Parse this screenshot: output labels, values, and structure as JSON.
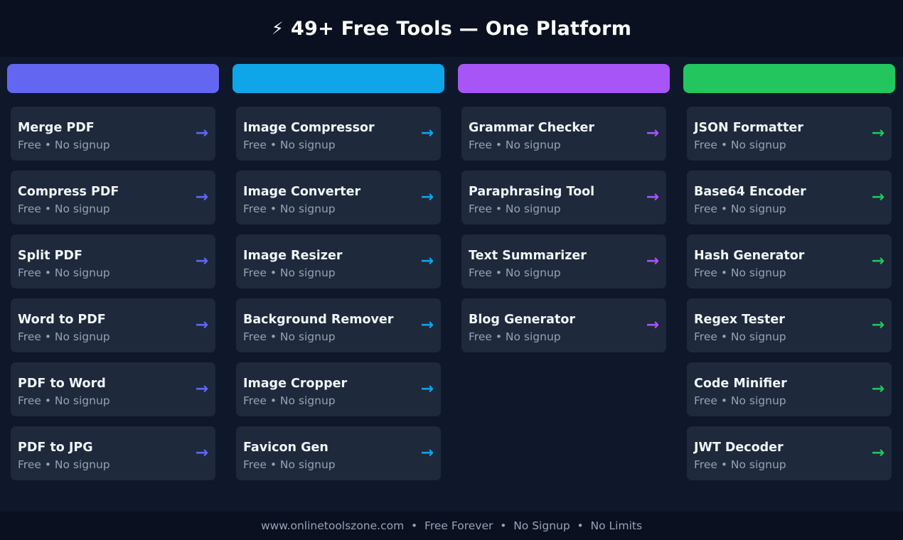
{
  "header": {
    "icon": "lightning-bolt-icon",
    "icon_glyph": "⚡",
    "title": "49+ Free Tools — One Platform"
  },
  "columns": [
    {
      "color": "#6366f1",
      "tools": [
        {
          "name": "Merge PDF",
          "subtitle": "Free • No signup"
        },
        {
          "name": "Compress PDF",
          "subtitle": "Free • No signup"
        },
        {
          "name": "Split PDF",
          "subtitle": "Free • No signup"
        },
        {
          "name": "Word to PDF",
          "subtitle": "Free • No signup"
        },
        {
          "name": "PDF to Word",
          "subtitle": "Free • No signup"
        },
        {
          "name": "PDF to JPG",
          "subtitle": "Free • No signup"
        }
      ]
    },
    {
      "color": "#0ea5e9",
      "tools": [
        {
          "name": "Image Compressor",
          "subtitle": "Free • No signup"
        },
        {
          "name": "Image Converter",
          "subtitle": "Free • No signup"
        },
        {
          "name": "Image Resizer",
          "subtitle": "Free • No signup"
        },
        {
          "name": "Background Remover",
          "subtitle": "Free • No signup"
        },
        {
          "name": "Image Cropper",
          "subtitle": "Free • No signup"
        },
        {
          "name": "Favicon Gen",
          "subtitle": "Free • No signup"
        }
      ]
    },
    {
      "color": "#a855f7",
      "tools": [
        {
          "name": "Grammar Checker",
          "subtitle": "Free • No signup"
        },
        {
          "name": "Paraphrasing Tool",
          "subtitle": "Free • No signup"
        },
        {
          "name": "Text Summarizer",
          "subtitle": "Free • No signup"
        },
        {
          "name": "Blog Generator",
          "subtitle": "Free • No signup"
        }
      ]
    },
    {
      "color": "#22c55e",
      "tools": [
        {
          "name": "JSON Formatter",
          "subtitle": "Free • No signup"
        },
        {
          "name": "Base64 Encoder",
          "subtitle": "Free • No signup"
        },
        {
          "name": "Hash Generator",
          "subtitle": "Free • No signup"
        },
        {
          "name": "Regex Tester",
          "subtitle": "Free • No signup"
        },
        {
          "name": "Code Minifier",
          "subtitle": "Free • No signup"
        },
        {
          "name": "JWT Decoder",
          "subtitle": "Free • No signup"
        }
      ]
    }
  ],
  "arrow": {
    "icon": "arrow-right-icon",
    "glyph": "→"
  },
  "footer": {
    "text": "www.onlinetoolszone.com  •  Free Forever  •  No Signup  •  No Limits"
  }
}
